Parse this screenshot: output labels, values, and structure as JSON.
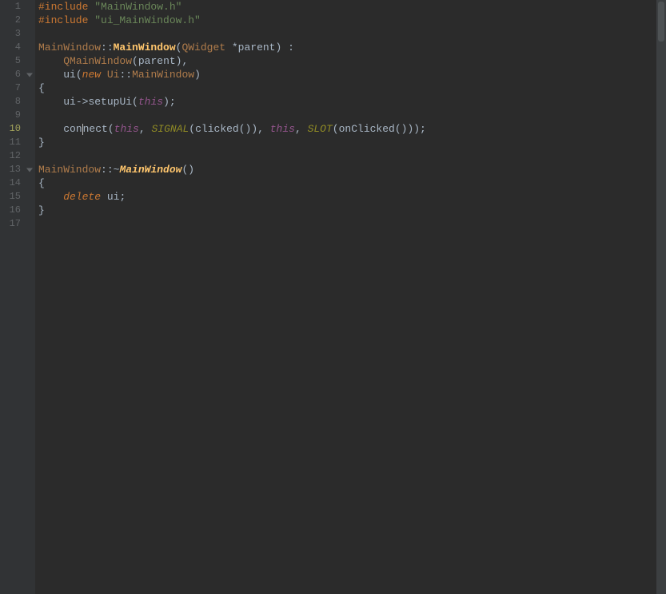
{
  "editor": {
    "current_line_index": 9,
    "fold_lines": [
      5,
      12
    ],
    "gutter": [
      "1",
      "2",
      "3",
      "4",
      "5",
      "6",
      "7",
      "8",
      "9",
      "10",
      "11",
      "12",
      "13",
      "14",
      "15",
      "16",
      "17"
    ],
    "lines": [
      [
        {
          "t": "#include ",
          "c": "tok-pp"
        },
        {
          "t": "\"MainWindow.h\"",
          "c": "tok-string"
        }
      ],
      [
        {
          "t": "#include ",
          "c": "tok-pp"
        },
        {
          "t": "\"ui_MainWindow.h\"",
          "c": "tok-string"
        }
      ],
      [],
      [
        {
          "t": "MainWindow",
          "c": "tok-class"
        },
        {
          "t": "::",
          "c": "tok-ns"
        },
        {
          "t": "MainWindow",
          "c": "tok-func"
        },
        {
          "t": "(",
          "c": "tok-paren"
        },
        {
          "t": "QWidget ",
          "c": "tok-type"
        },
        {
          "t": "*parent",
          "c": "tok-param"
        },
        {
          "t": ")",
          "c": "tok-paren"
        },
        {
          "t": " :",
          "c": "tok-punc"
        }
      ],
      [
        {
          "t": "    ",
          "c": ""
        },
        {
          "t": "QMainWindow",
          "c": "tok-type"
        },
        {
          "t": "(",
          "c": "tok-paren"
        },
        {
          "t": "parent",
          "c": "tok-param"
        },
        {
          "t": ")",
          "c": "tok-paren"
        },
        {
          "t": ",",
          "c": "tok-punc"
        }
      ],
      [
        {
          "t": "    ",
          "c": ""
        },
        {
          "t": "ui",
          "c": "tok-param"
        },
        {
          "t": "(",
          "c": "tok-paren"
        },
        {
          "t": "new ",
          "c": "tok-kw"
        },
        {
          "t": "Ui",
          "c": "tok-type"
        },
        {
          "t": "::",
          "c": "tok-ns"
        },
        {
          "t": "MainWindow",
          "c": "tok-type"
        },
        {
          "t": ")",
          "c": "tok-paren"
        }
      ],
      [
        {
          "t": "{",
          "c": "tok-punc"
        }
      ],
      [
        {
          "t": "    ",
          "c": ""
        },
        {
          "t": "ui",
          "c": "tok-param"
        },
        {
          "t": "->",
          "c": "tok-op"
        },
        {
          "t": "setupUi",
          "c": "tok-param"
        },
        {
          "t": "(",
          "c": "tok-paren"
        },
        {
          "t": "this",
          "c": "tok-this"
        },
        {
          "t": ")",
          "c": "tok-paren"
        },
        {
          "t": ";",
          "c": "tok-punc"
        }
      ],
      [],
      [
        {
          "t": "    ",
          "c": ""
        },
        {
          "t": "con",
          "c": "tok-param"
        },
        {
          "cursor": true
        },
        {
          "t": "nect",
          "c": "tok-param"
        },
        {
          "t": "(",
          "c": "tok-paren"
        },
        {
          "t": "this",
          "c": "tok-this"
        },
        {
          "t": ", ",
          "c": "tok-punc"
        },
        {
          "t": "SIGNAL",
          "c": "tok-macro"
        },
        {
          "t": "(",
          "c": "tok-paren"
        },
        {
          "t": "clicked",
          "c": "tok-param"
        },
        {
          "t": "()",
          "c": "tok-paren"
        },
        {
          "t": ")",
          "c": "tok-paren"
        },
        {
          "t": ", ",
          "c": "tok-punc"
        },
        {
          "t": "this",
          "c": "tok-this"
        },
        {
          "t": ", ",
          "c": "tok-punc"
        },
        {
          "t": "SLOT",
          "c": "tok-macro"
        },
        {
          "t": "(",
          "c": "tok-paren"
        },
        {
          "t": "onClicked",
          "c": "tok-param"
        },
        {
          "t": "()",
          "c": "tok-paren"
        },
        {
          "t": "))",
          "c": "tok-paren"
        },
        {
          "t": ";",
          "c": "tok-punc"
        }
      ],
      [
        {
          "t": "}",
          "c": "tok-punc"
        }
      ],
      [],
      [
        {
          "t": "MainWindow",
          "c": "tok-class"
        },
        {
          "t": "::",
          "c": "tok-ns"
        },
        {
          "t": "~",
          "c": "tok-punc"
        },
        {
          "t": "MainWindow",
          "c": "tok-func-it"
        },
        {
          "t": "()",
          "c": "tok-paren"
        }
      ],
      [
        {
          "t": "{",
          "c": "tok-punc"
        }
      ],
      [
        {
          "t": "    ",
          "c": ""
        },
        {
          "t": "delete ",
          "c": "tok-kw"
        },
        {
          "t": "ui",
          "c": "tok-param"
        },
        {
          "t": ";",
          "c": "tok-punc"
        }
      ],
      [
        {
          "t": "}",
          "c": "tok-punc"
        }
      ],
      []
    ]
  }
}
